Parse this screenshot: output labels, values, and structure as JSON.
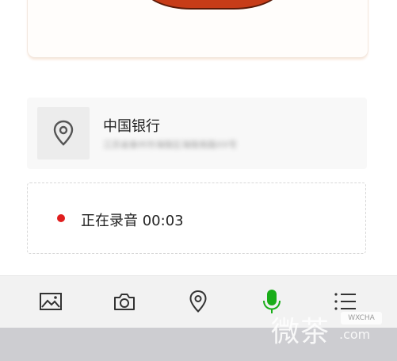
{
  "location": {
    "title": "中国银行",
    "address": "江苏省泰州市海陵区海陵南路XX号"
  },
  "recording": {
    "status": "正在录音 00:03",
    "dot_color": "#e01e1e"
  },
  "toolbar": {
    "items": [
      {
        "icon": "image-icon",
        "active": false
      },
      {
        "icon": "camera-icon",
        "active": false
      },
      {
        "icon": "location-pin-icon",
        "active": false
      },
      {
        "icon": "microphone-icon",
        "active": true,
        "color": "#1aad19"
      },
      {
        "icon": "list-icon",
        "active": false
      }
    ]
  },
  "watermark": {
    "text": "微茶",
    "badge": "WXCHA",
    "url": ".com"
  }
}
